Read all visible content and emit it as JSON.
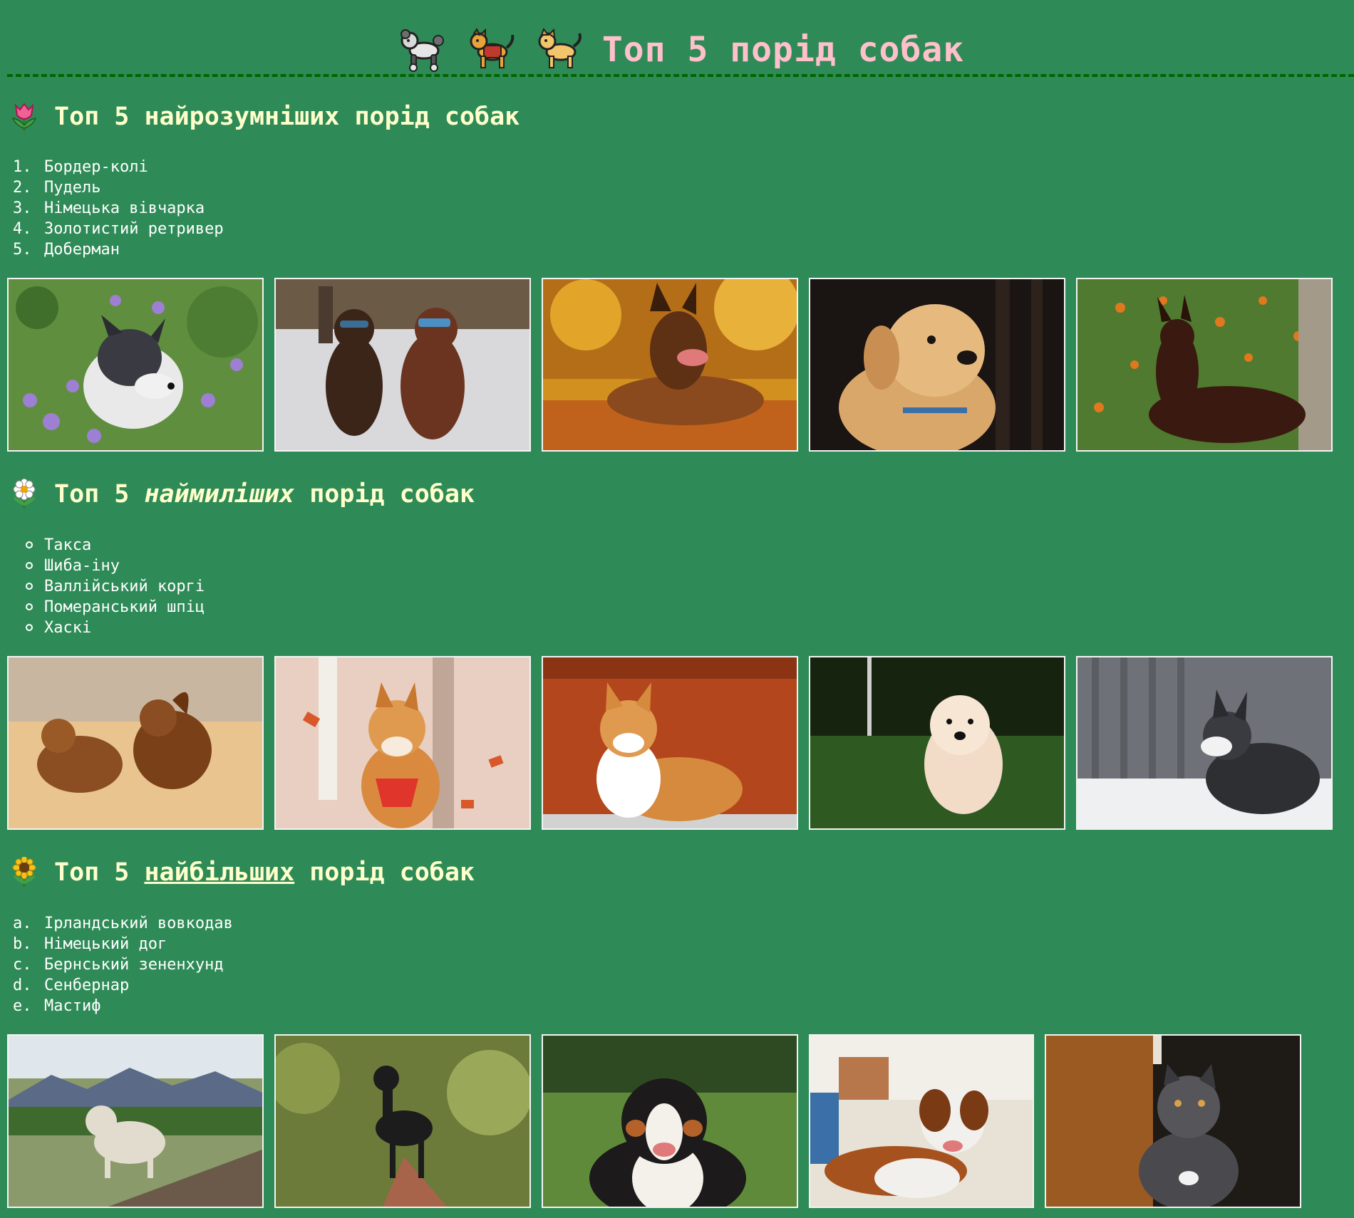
{
  "header": {
    "title": "Топ 5 порід собак",
    "icons": [
      "poodle-emoji",
      "service-dog-emoji",
      "dog-emoji"
    ]
  },
  "sections": [
    {
      "icon": "tulip-icon",
      "title_before": "Топ 5 ",
      "title_highlight": "найрозумніших",
      "title_after": " порід собак",
      "highlight_style": "bold",
      "list_style": "decimal",
      "markers": [
        "1.",
        "2.",
        "3.",
        "4.",
        "5."
      ],
      "items": [
        "Бордер-колі",
        "Пудель",
        "Німецька вівчарка",
        "Золотистий ретривер",
        "Доберман"
      ],
      "photos": [
        "border-collie-photo",
        "poodle-photo",
        "german-shepherd-photo",
        "golden-retriever-photo",
        "doberman-photo"
      ]
    },
    {
      "icon": "daisy-icon",
      "title_before": "Топ 5 ",
      "title_highlight": "наймиліших",
      "title_after": " порід собак",
      "highlight_style": "italic",
      "list_style": "circle",
      "markers": [
        "",
        "",
        "",
        "",
        ""
      ],
      "items": [
        "Такса",
        "Шиба-іну",
        "Валлійський коргі",
        "Померанський шпіц",
        "Хаскі"
      ],
      "photos": [
        "dachshund-photo",
        "shiba-inu-photo",
        "corgi-photo",
        "pomeranian-photo",
        "husky-photo"
      ]
    },
    {
      "icon": "sunflower-icon",
      "title_before": "Топ 5 ",
      "title_highlight": "найбільших",
      "title_after": " порід собак",
      "highlight_style": "underline",
      "list_style": "lower-alpha",
      "markers": [
        "a.",
        "b.",
        "c.",
        "d.",
        "e."
      ],
      "items": [
        "Ірландський вовкодав",
        "Німецький дог",
        "Бернський зененхунд",
        "Сенбернар",
        "Мастиф"
      ],
      "photos": [
        "irish-wolfhound-photo",
        "great-dane-photo",
        "bernese-mountain-dog-photo",
        "saint-bernard-photo",
        "mastiff-photo"
      ]
    }
  ],
  "colors": {
    "background": "#2e8b57",
    "title": "#ffc0cb",
    "heading": "#ffffcc",
    "divider": "#006400",
    "photo_border": "#f4f4f4"
  }
}
